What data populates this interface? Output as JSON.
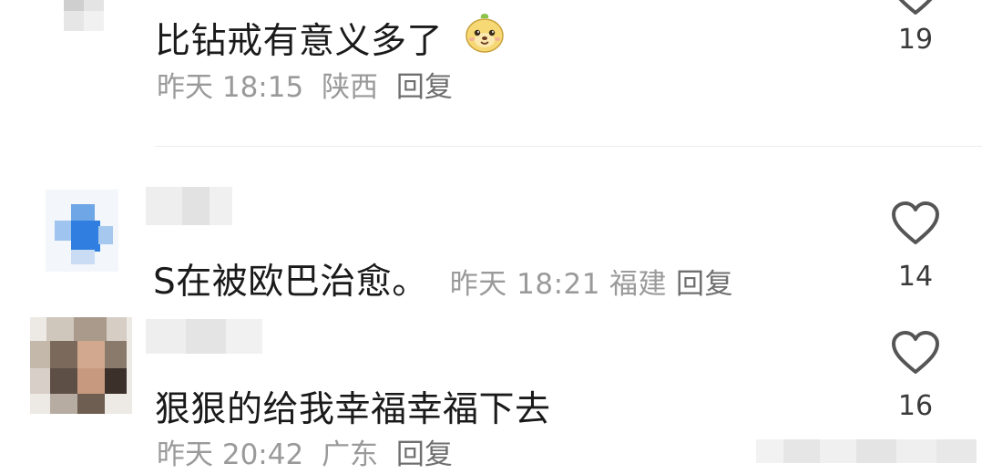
{
  "comments": [
    {
      "text": "比钻戒有意义多了",
      "emoji": "yellow-creature-emoji",
      "time": "昨天 18:15",
      "location": "陕西",
      "reply_label": "回复",
      "likes": "19"
    },
    {
      "text": "S在被欧巴治愈。",
      "time": "昨天 18:21",
      "location": "福建",
      "reply_label": "回复",
      "likes": "14"
    },
    {
      "text": "狠狠的给我幸福幸福下去",
      "time": "昨天 20:42",
      "location": "广东",
      "reply_label": "回复",
      "likes": "16"
    }
  ],
  "icons": {
    "like": "heart-outline-icon",
    "avatar": "pixelated-avatar"
  },
  "colors": {
    "text_primary": "#1a1a1a",
    "text_meta": "#9a9a9a",
    "reply": "#6f6f6f",
    "heart_stroke": "#555555",
    "divider": "#ececec"
  }
}
